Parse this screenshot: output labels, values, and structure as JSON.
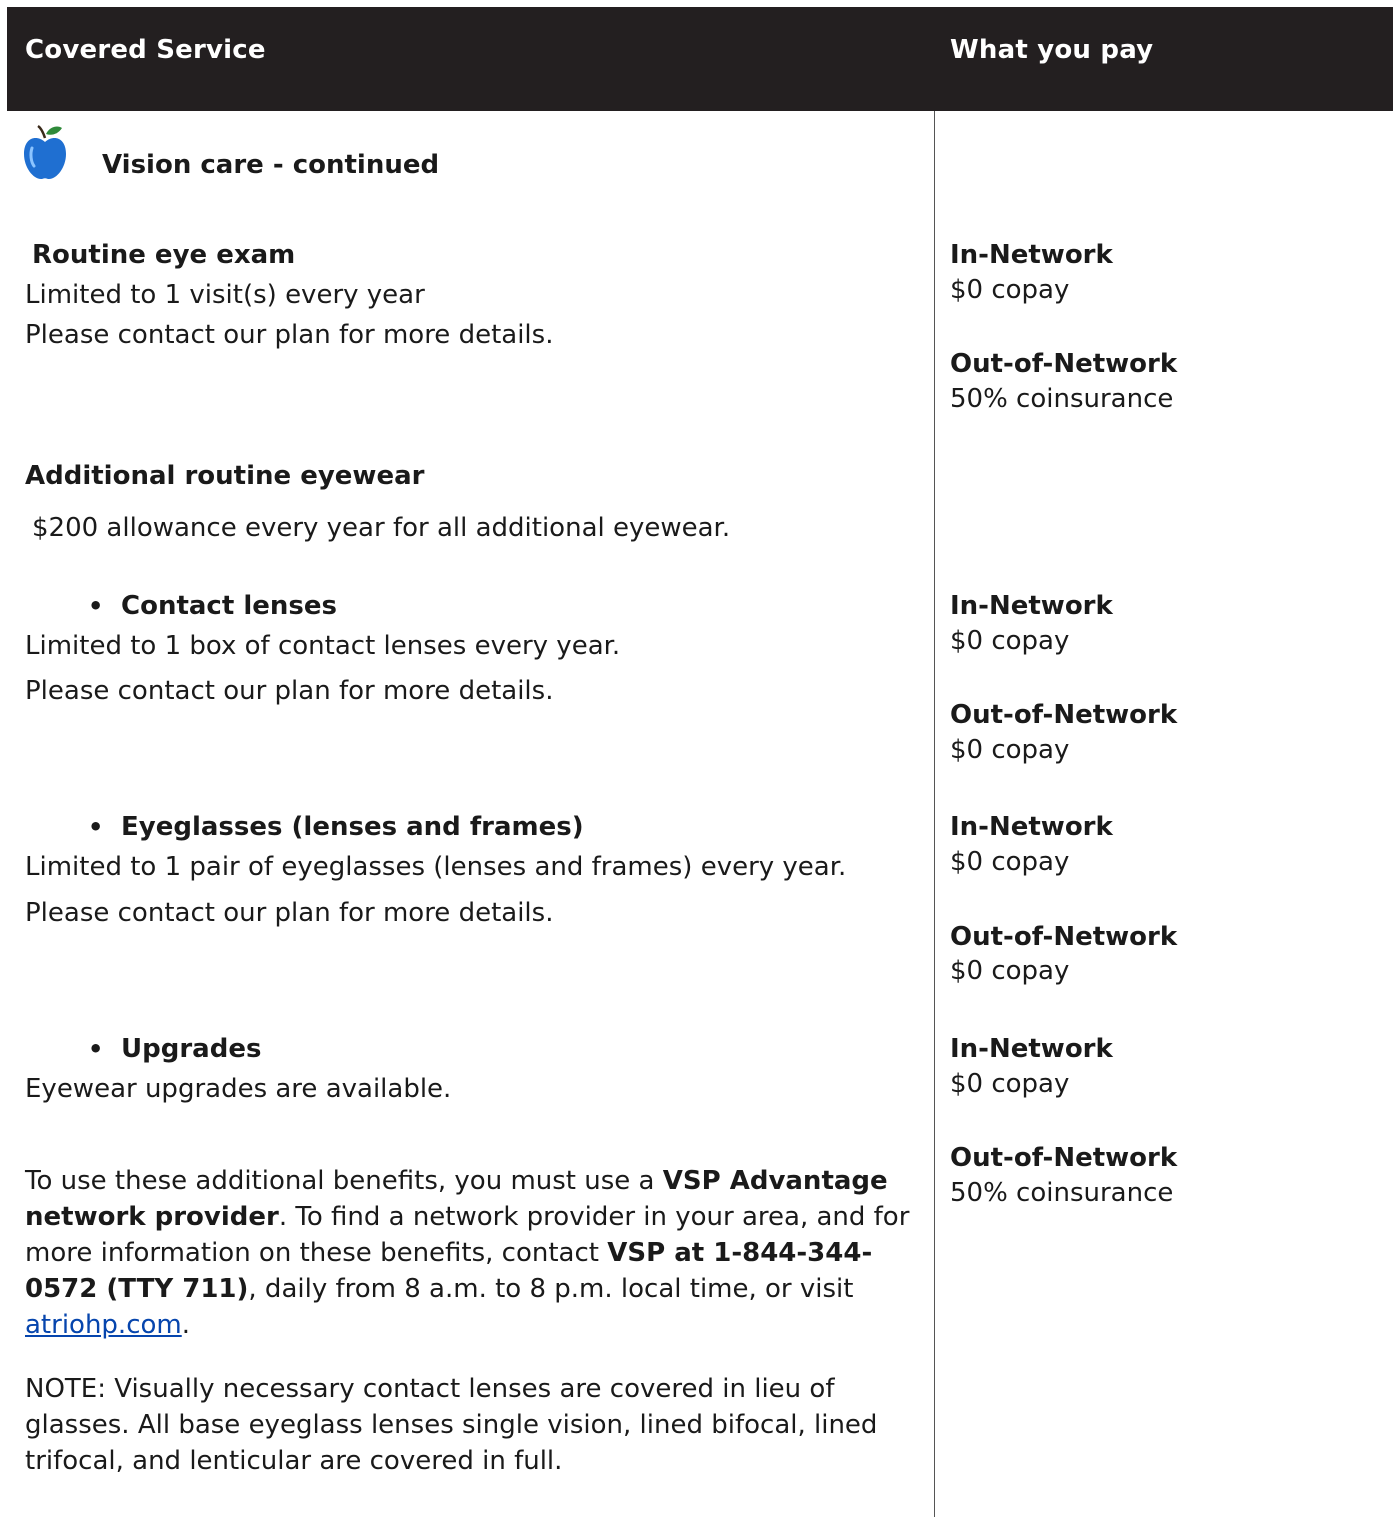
{
  "header": {
    "col_service": "Covered Service",
    "col_pay": "What you pay"
  },
  "section": {
    "icon": "apple-icon",
    "title": "Vision care - continued"
  },
  "routine_exam": {
    "title": "Routine eye exam",
    "line1": "Limited to 1 visit(s) every year",
    "line2": "Please contact our plan for more details.",
    "in_label": "In-Network",
    "in_value": "$0 copay",
    "out_label": "Out-of-Network",
    "out_value": "50% coinsurance"
  },
  "additional": {
    "title": "Additional routine eyewear",
    "allowance": "$200 allowance every year for all additional eyewear."
  },
  "contact_lenses": {
    "bullet": "•",
    "title": "Contact lenses",
    "line1": "Limited to 1 box of contact lenses every year.",
    "line2": "Please contact our plan for more details.",
    "in_label": "In-Network",
    "in_value": "$0 copay",
    "out_label": "Out-of-Network",
    "out_value": "$0 copay"
  },
  "eyeglasses": {
    "bullet": "•",
    "title": "Eyeglasses (lenses and frames)",
    "line1": "Limited to 1 pair of eyeglasses (lenses and frames) every year.",
    "line2": "Please contact our plan for more details.",
    "in_label": "In-Network",
    "in_value": "$0 copay",
    "out_label": "Out-of-Network",
    "out_value": "$0 copay"
  },
  "upgrades": {
    "bullet": "•",
    "title": "Upgrades",
    "line1": "Eyewear upgrades are available.",
    "in_label": "In-Network",
    "in_value": "$0 copay",
    "out_label": "Out-of-Network",
    "out_value": "50% coinsurance"
  },
  "info": {
    "p1_a": "To use these additional benefits, you must use a ",
    "p1_b": "VSP Advantage network provider",
    "p1_c": ". To find a network provider in your area, and for more information on these benefits, contact ",
    "p1_d": "VSP at 1-844-344-0572 (TTY 711)",
    "p1_e": ", daily from 8 a.m. to 8 p.m. local time, or visit ",
    "link": "atriohp.com",
    "p1_f": ".",
    "note": "NOTE:  Visually necessary contact lenses are covered in lieu of glasses. All base eyeglass lenses single vision, lined bifocal, lined trifocal, and lenticular are covered in full."
  },
  "colors": {
    "header_bg": "#231f20",
    "header_text": "#ffffff",
    "link": "#0645ad",
    "apple_body": "#1f6fd1",
    "apple_leaf": "#2f8a3a"
  }
}
